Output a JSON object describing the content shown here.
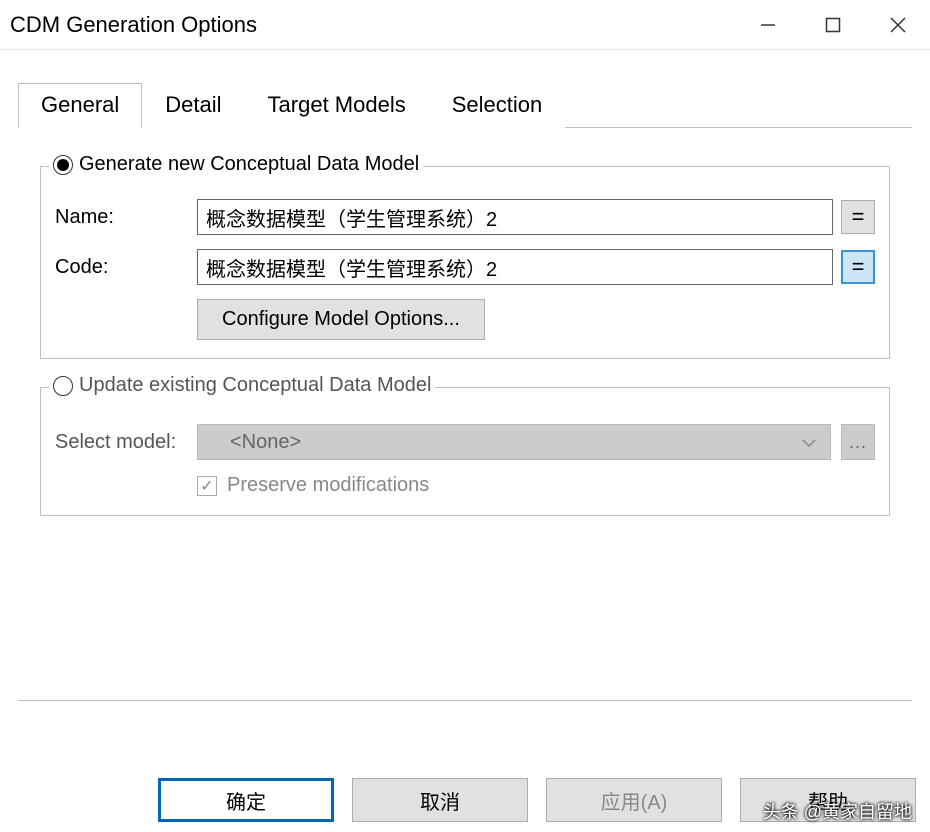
{
  "window": {
    "title": "CDM Generation Options"
  },
  "tabs": {
    "general": "General",
    "detail": "Detail",
    "target_models": "Target Models",
    "selection": "Selection"
  },
  "generate_group": {
    "legend": "Generate new Conceptual Data Model",
    "name_label": "Name:",
    "name_value": "概念数据模型（学生管理系统）2",
    "code_label": "Code:",
    "code_value": "概念数据模型（学生管理系统）2",
    "eq_symbol": "=",
    "configure_btn": "Configure Model Options..."
  },
  "update_group": {
    "legend": "Update existing Conceptual Data Model",
    "select_label": "Select model:",
    "select_value": "<None>",
    "ellipsis": "...",
    "preserve_label": "Preserve modifications",
    "check_mark": "✓"
  },
  "buttons": {
    "ok": "确定",
    "cancel": "取消",
    "apply": "应用(A)",
    "help": "帮助"
  },
  "watermark": "头条 @黄家自留地"
}
